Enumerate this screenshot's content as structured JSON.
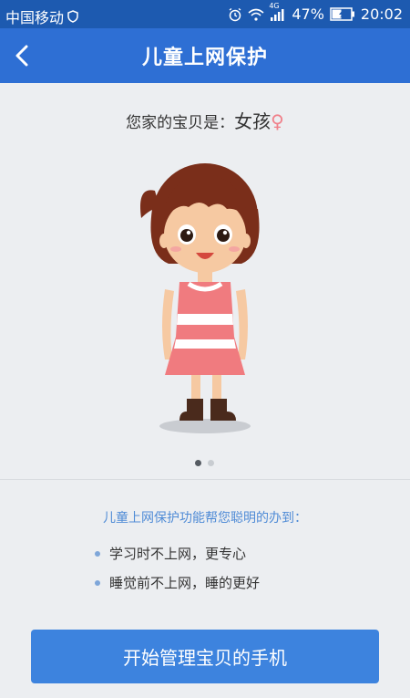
{
  "status_bar": {
    "carrier": "中国移动",
    "network": "4G",
    "battery": "47%",
    "time": "20:02"
  },
  "header": {
    "title": "儿童上网保护"
  },
  "profile": {
    "label": "您家的宝贝是：",
    "gender": "女孩",
    "gender_symbol": "♀"
  },
  "features": {
    "intro": "儿童上网保护功能帮您聪明的办到：",
    "items": [
      {
        "text": "学习时不上网，更专心"
      },
      {
        "text": "睡觉前不上网，睡的更好"
      }
    ]
  },
  "cta": {
    "label": "开始管理宝贝的手机"
  }
}
